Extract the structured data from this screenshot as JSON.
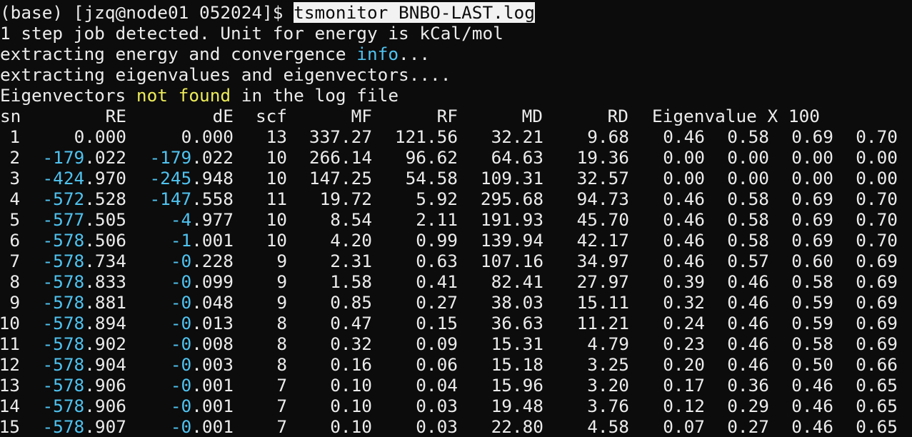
{
  "prompt": "(base) [jzq@node01 052024]$ ",
  "command": "tsmonitor BNBO-LAST.log",
  "messages": [
    {
      "segments": [
        {
          "text": "1 step job detected. Unit for energy is kCal/mol",
          "color": ""
        }
      ]
    },
    {
      "segments": [
        {
          "text": "extracting energy and convergence ",
          "color": ""
        },
        {
          "text": "info",
          "color": "blue"
        },
        {
          "text": "...",
          "color": ""
        }
      ]
    },
    {
      "segments": [
        {
          "text": "extracting eigenvalues and eigenvectors....",
          "color": ""
        }
      ]
    },
    {
      "segments": [
        {
          "text": "Eigenvectors ",
          "color": ""
        },
        {
          "text": "not found",
          "color": "yellow"
        },
        {
          "text": " in the log file",
          "color": ""
        }
      ]
    }
  ],
  "table": {
    "headers": {
      "sn": "sn",
      "re": "RE",
      "de": "dE",
      "scf": "scf",
      "mf": "MF",
      "rf": "RF",
      "md": "MD",
      "rd": "RD",
      "eig": "Eigenvalue X 100"
    },
    "rows": [
      {
        "sn": "1",
        "re_neg": "",
        "re_rest": "0.000",
        "de_neg": "",
        "de_rest": "0.000",
        "scf": "13",
        "mf": "337.27",
        "rf": "121.56",
        "md": "32.21",
        "rd": "9.68",
        "ev": [
          "0.46",
          "0.58",
          "0.69",
          "0.70"
        ]
      },
      {
        "sn": "2",
        "re_neg": "-179",
        "re_rest": ".022",
        "de_neg": "-179",
        "de_rest": ".022",
        "scf": "10",
        "mf": "266.14",
        "rf": "96.62",
        "md": "64.63",
        "rd": "19.36",
        "ev": [
          "0.00",
          "0.00",
          "0.00",
          "0.00"
        ]
      },
      {
        "sn": "3",
        "re_neg": "-424",
        "re_rest": ".970",
        "de_neg": "-245",
        "de_rest": ".948",
        "scf": "10",
        "mf": "147.25",
        "rf": "54.58",
        "md": "109.31",
        "rd": "32.57",
        "ev": [
          "0.00",
          "0.00",
          "0.00",
          "0.00"
        ]
      },
      {
        "sn": "4",
        "re_neg": "-572",
        "re_rest": ".528",
        "de_neg": "-147",
        "de_rest": ".558",
        "scf": "11",
        "mf": "19.72",
        "rf": "5.92",
        "md": "295.68",
        "rd": "94.73",
        "ev": [
          "0.46",
          "0.58",
          "0.69",
          "0.70"
        ]
      },
      {
        "sn": "5",
        "re_neg": "-577",
        "re_rest": ".505",
        "de_neg": "-4",
        "de_rest": ".977",
        "scf": "10",
        "mf": "8.54",
        "rf": "2.11",
        "md": "191.93",
        "rd": "45.70",
        "ev": [
          "0.46",
          "0.58",
          "0.69",
          "0.70"
        ]
      },
      {
        "sn": "6",
        "re_neg": "-578",
        "re_rest": ".506",
        "de_neg": "-1",
        "de_rest": ".001",
        "scf": "10",
        "mf": "4.20",
        "rf": "0.99",
        "md": "139.94",
        "rd": "42.17",
        "ev": [
          "0.46",
          "0.58",
          "0.69",
          "0.70"
        ]
      },
      {
        "sn": "7",
        "re_neg": "-578",
        "re_rest": ".734",
        "de_neg": "-0",
        "de_rest": ".228",
        "scf": "9",
        "mf": "2.31",
        "rf": "0.63",
        "md": "107.16",
        "rd": "34.97",
        "ev": [
          "0.46",
          "0.57",
          "0.60",
          "0.69"
        ]
      },
      {
        "sn": "8",
        "re_neg": "-578",
        "re_rest": ".833",
        "de_neg": "-0",
        "de_rest": ".099",
        "scf": "9",
        "mf": "1.58",
        "rf": "0.41",
        "md": "82.41",
        "rd": "27.97",
        "ev": [
          "0.39",
          "0.46",
          "0.58",
          "0.69"
        ]
      },
      {
        "sn": "9",
        "re_neg": "-578",
        "re_rest": ".881",
        "de_neg": "-0",
        "de_rest": ".048",
        "scf": "9",
        "mf": "0.85",
        "rf": "0.27",
        "md": "38.03",
        "rd": "15.11",
        "ev": [
          "0.32",
          "0.46",
          "0.59",
          "0.69"
        ]
      },
      {
        "sn": "10",
        "re_neg": "-578",
        "re_rest": ".894",
        "de_neg": "-0",
        "de_rest": ".013",
        "scf": "8",
        "mf": "0.47",
        "rf": "0.15",
        "md": "36.63",
        "rd": "11.21",
        "ev": [
          "0.24",
          "0.46",
          "0.59",
          "0.69"
        ]
      },
      {
        "sn": "11",
        "re_neg": "-578",
        "re_rest": ".902",
        "de_neg": "-0",
        "de_rest": ".008",
        "scf": "8",
        "mf": "0.32",
        "rf": "0.09",
        "md": "15.31",
        "rd": "4.79",
        "ev": [
          "0.23",
          "0.46",
          "0.58",
          "0.69"
        ]
      },
      {
        "sn": "12",
        "re_neg": "-578",
        "re_rest": ".904",
        "de_neg": "-0",
        "de_rest": ".003",
        "scf": "8",
        "mf": "0.16",
        "rf": "0.06",
        "md": "15.18",
        "rd": "3.25",
        "ev": [
          "0.20",
          "0.46",
          "0.50",
          "0.66"
        ]
      },
      {
        "sn": "13",
        "re_neg": "-578",
        "re_rest": ".906",
        "de_neg": "-0",
        "de_rest": ".001",
        "scf": "7",
        "mf": "0.10",
        "rf": "0.04",
        "md": "15.96",
        "rd": "3.20",
        "ev": [
          "0.17",
          "0.36",
          "0.46",
          "0.65"
        ]
      },
      {
        "sn": "14",
        "re_neg": "-578",
        "re_rest": ".906",
        "de_neg": "-0",
        "de_rest": ".001",
        "scf": "7",
        "mf": "0.10",
        "rf": "0.03",
        "md": "19.48",
        "rd": "3.76",
        "ev": [
          "0.12",
          "0.29",
          "0.46",
          "0.65"
        ]
      },
      {
        "sn": "15",
        "re_neg": "-578",
        "re_rest": ".907",
        "de_neg": "-0",
        "de_rest": ".001",
        "scf": "7",
        "mf": "0.10",
        "rf": "0.03",
        "md": "22.80",
        "rd": "4.58",
        "ev": [
          "0.07",
          "0.27",
          "0.46",
          "0.65"
        ]
      }
    ]
  },
  "colors": {
    "background": "#0c0c0c",
    "foreground": "#ececec",
    "highlight_bg": "#f2f2f2",
    "highlight_fg": "#0c0c0c",
    "blue": "#4fc3f0",
    "yellow": "#ecec5a"
  }
}
